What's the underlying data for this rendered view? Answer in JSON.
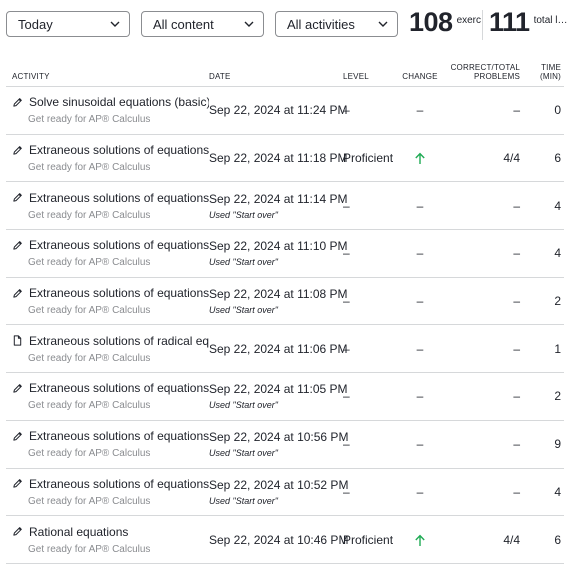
{
  "filters": {
    "period": "Today",
    "content": "All content",
    "activities": "All activities"
  },
  "stats": {
    "exercise_minutes": "108",
    "exercise_label": "exercise min",
    "learning_minutes": "111",
    "learning_label": "total learning min"
  },
  "columns": {
    "activity": "ACTIVITY",
    "date": "DATE",
    "level": "LEVEL",
    "change": "CHANGE",
    "correct_total_line1": "CORRECT/TOTAL",
    "correct_total_line2": "PROBLEMS",
    "time_line1": "TIME",
    "time_line2": "(MIN)"
  },
  "colors": {
    "accent_up": "#1fab54",
    "divider": "#d6d8da",
    "subtext": "#8a8c90"
  },
  "rows": [
    {
      "icon": "pencil-icon",
      "title": "Solve sinusoidal equations (basic)",
      "course": "Get ready for AP® Calculus",
      "date": "Sep 22, 2024 at 11:24 PM",
      "note": "",
      "level": "–",
      "change": "–",
      "correct": "–",
      "time": "0"
    },
    {
      "icon": "pencil-icon",
      "title": "Extraneous solutions of equations",
      "course": "Get ready for AP® Calculus",
      "date": "Sep 22, 2024 at 11:18 PM",
      "note": "",
      "level": "Proficient",
      "change": "up-arrow",
      "correct": "4/4",
      "time": "6"
    },
    {
      "icon": "pencil-icon",
      "title": "Extraneous solutions of equations",
      "course": "Get ready for AP® Calculus",
      "date": "Sep 22, 2024 at 11:14 PM",
      "note": "Used \"Start over\"",
      "level": "–",
      "change": "–",
      "correct": "–",
      "time": "4"
    },
    {
      "icon": "pencil-icon",
      "title": "Extraneous solutions of equations",
      "course": "Get ready for AP® Calculus",
      "date": "Sep 22, 2024 at 11:10 PM",
      "note": "Used \"Start over\"",
      "level": "–",
      "change": "–",
      "correct": "–",
      "time": "4"
    },
    {
      "icon": "pencil-icon",
      "title": "Extraneous solutions of equations",
      "course": "Get ready for AP® Calculus",
      "date": "Sep 22, 2024 at 11:08 PM",
      "note": "Used \"Start over\"",
      "level": "–",
      "change": "–",
      "correct": "–",
      "time": "2"
    },
    {
      "icon": "document-icon",
      "title": "Extraneous solutions of radical eq...",
      "course": "Get ready for AP® Calculus",
      "date": "Sep 22, 2024 at 11:06 PM",
      "note": "",
      "level": "–",
      "change": "–",
      "correct": "–",
      "time": "1"
    },
    {
      "icon": "pencil-icon",
      "title": "Extraneous solutions of equations",
      "course": "Get ready for AP® Calculus",
      "date": "Sep 22, 2024 at 11:05 PM",
      "note": "Used \"Start over\"",
      "level": "–",
      "change": "–",
      "correct": "–",
      "time": "2"
    },
    {
      "icon": "pencil-icon",
      "title": "Extraneous solutions of equations",
      "course": "Get ready for AP® Calculus",
      "date": "Sep 22, 2024 at 10:56 PM",
      "note": "Used \"Start over\"",
      "level": "–",
      "change": "–",
      "correct": "–",
      "time": "9"
    },
    {
      "icon": "pencil-icon",
      "title": "Extraneous solutions of equations",
      "course": "Get ready for AP® Calculus",
      "date": "Sep 22, 2024 at 10:52 PM",
      "note": "Used \"Start over\"",
      "level": "–",
      "change": "–",
      "correct": "–",
      "time": "4"
    },
    {
      "icon": "pencil-icon",
      "title": "Rational equations",
      "course": "Get ready for AP® Calculus",
      "date": "Sep 22, 2024 at 10:46 PM",
      "note": "",
      "level": "Proficient",
      "change": "up-arrow",
      "correct": "4/4",
      "time": "6"
    }
  ]
}
